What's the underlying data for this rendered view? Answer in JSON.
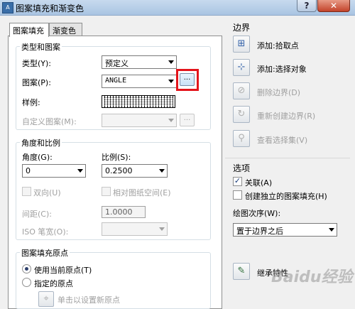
{
  "window": {
    "title": "图案填充和渐变色",
    "app_icon_text": "A",
    "help_glyph": "?",
    "close_glyph": "✕"
  },
  "tabs": [
    {
      "label": "图案填充",
      "selected": true
    },
    {
      "label": "渐变色",
      "selected": false
    }
  ],
  "type_pattern": {
    "title": "类型和图案",
    "type_label": "类型(Y):",
    "type_value": "预定义",
    "pattern_label": "图案(P):",
    "pattern_value": "ANGLE",
    "pattern_button": "...",
    "sample_label": "样例:",
    "custom_label": "自定义图案(M):",
    "custom_value": "",
    "custom_button": "..."
  },
  "angle_scale": {
    "title": "角度和比例",
    "angle_label": "角度(G):",
    "angle_value": "0",
    "scale_label": "比例(S):",
    "scale_value": "0.2500",
    "double_label": "双向(U)",
    "relative_label": "相对图纸空间(E)",
    "spacing_label": "间距(C):",
    "spacing_value": "1.0000",
    "iso_label": "ISO 笔宽(O):",
    "iso_value": ""
  },
  "origin": {
    "title": "图案填充原点",
    "use_current": "使用当前原点(T)",
    "use_current_selected": true,
    "specified": "指定的原点",
    "click_set": "单击以设置新原点"
  },
  "boundary": {
    "title": "边界",
    "add_pick": "添加:拾取点",
    "add_select": "添加:选择对象",
    "remove": "删除边界(D)",
    "recreate": "重新创建边界(R)",
    "view": "查看选择集(V)"
  },
  "options": {
    "title": "选项",
    "associative": "关联(A)",
    "associative_checked": true,
    "independent": "创建独立的图案填充(H)",
    "independent_checked": false,
    "draw_order_label": "绘图次序(W):",
    "draw_order_value": "置于边界之后"
  },
  "inherit": {
    "label": "继承特性"
  },
  "watermark": "Baidu经验",
  "icons": {
    "pick": "pick-points-icon",
    "select": "select-objects-icon",
    "remove": "remove-boundary-icon",
    "recreate": "recreate-boundary-icon",
    "view": "view-selection-icon",
    "inherit": "inherit-properties-icon",
    "origin": "set-origin-icon"
  },
  "colors": {
    "highlight": "#e3141b",
    "title_bar": "#b8cfe8",
    "close": "#c3432a"
  }
}
